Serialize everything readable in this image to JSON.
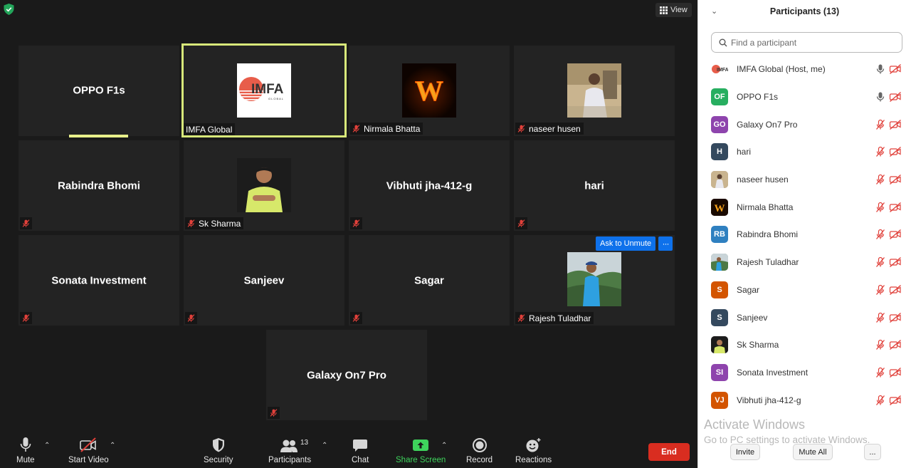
{
  "view_label": "View",
  "tiles": {
    "oppo": "OPPO F1s",
    "imfa_label": "IMFA Global",
    "imfa_logo_text": "IMFA",
    "imfa_logo_sub": "GLOBAL",
    "nirmala_label": "Nirmala Bhatta",
    "naseer_label": "naseer husen",
    "rabindra": "Rabindra Bhomi",
    "sk_label": "Sk Sharma",
    "vibhuti": "Vibhuti jha-412-g",
    "hari": "hari",
    "sonata": "Sonata Investment",
    "sanjeev": "Sanjeev",
    "sagar": "Sagar",
    "rajesh_label": "Rajesh Tuladhar",
    "galaxy": "Galaxy On7 Pro"
  },
  "ask_unmute": "Ask to Unmute",
  "more_dots": "···",
  "toolbar": {
    "mute": "Mute",
    "start_video": "Start Video",
    "security": "Security",
    "participants": "Participants",
    "participants_count": "13",
    "chat": "Chat",
    "share_screen": "Share Screen",
    "record": "Record",
    "reactions": "Reactions",
    "end": "End"
  },
  "panel": {
    "title": "Participants (13)",
    "search_placeholder": "Find a participant",
    "participants": [
      {
        "initials": "IMFA",
        "name": "IMFA Global (Host, me)",
        "color": "#ffffff",
        "mic": "on",
        "photo": "imfa"
      },
      {
        "initials": "OF",
        "name": "OPPO F1s",
        "color": "#27ae60",
        "mic": "on",
        "photo": ""
      },
      {
        "initials": "GO",
        "name": "Galaxy On7 Pro",
        "color": "#8e44ad",
        "mic": "muted",
        "photo": ""
      },
      {
        "initials": "H",
        "name": "hari",
        "color": "#34495e",
        "mic": "muted",
        "photo": ""
      },
      {
        "initials": "",
        "name": "naseer husen",
        "color": "#9c8b74",
        "mic": "muted",
        "photo": "naseer"
      },
      {
        "initials": "",
        "name": "Nirmala Bhatta",
        "color": "#1a0a00",
        "mic": "muted",
        "photo": "nirmala"
      },
      {
        "initials": "RB",
        "name": "Rabindra Bhomi",
        "color": "#2f80c0",
        "mic": "muted",
        "photo": ""
      },
      {
        "initials": "",
        "name": "Rajesh Tuladhar",
        "color": "#5d8a6a",
        "mic": "muted",
        "photo": "rajesh"
      },
      {
        "initials": "S",
        "name": "Sagar",
        "color": "#d35400",
        "mic": "muted",
        "photo": ""
      },
      {
        "initials": "S",
        "name": "Sanjeev",
        "color": "#34495e",
        "mic": "muted",
        "photo": ""
      },
      {
        "initials": "",
        "name": "Sk Sharma",
        "color": "#2a2a2a",
        "mic": "muted",
        "photo": "sk"
      },
      {
        "initials": "SI",
        "name": "Sonata Investment",
        "color": "#8e44ad",
        "mic": "muted",
        "photo": ""
      },
      {
        "initials": "VJ",
        "name": "Vibhuti jha-412-g",
        "color": "#d35400",
        "mic": "muted",
        "photo": ""
      }
    ],
    "activate_title": "Activate Windows",
    "activate_sub": "Go to PC settings to activate Windows.",
    "invite": "Invite",
    "mute_all": "Mute All",
    "more": "..."
  },
  "colors": {
    "active_speaker": "#d8e87a",
    "muted_red": "#e0403a",
    "share_green": "#3ed35c",
    "end_red": "#d92d20",
    "ask_blue": "#0e71eb"
  }
}
